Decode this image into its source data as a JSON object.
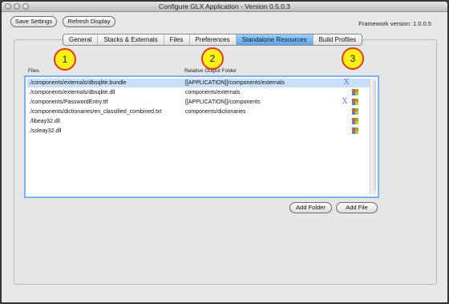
{
  "window": {
    "title": "Configure GLX Application - Version 0.5.0.3"
  },
  "toolbar": {
    "save_label": "Save Settings",
    "refresh_label": "Refresh Display"
  },
  "framework_version": "Framework version: 1.0.0.5",
  "tabs": [
    {
      "label": "General",
      "active": false
    },
    {
      "label": "Stacks & Externals",
      "active": false
    },
    {
      "label": "Files",
      "active": false
    },
    {
      "label": "Preferences",
      "active": false
    },
    {
      "label": "Standalone Resources",
      "active": true
    },
    {
      "label": "Build Profiles",
      "active": false
    }
  ],
  "callouts": [
    "1",
    "2",
    "3"
  ],
  "columns": {
    "files": "Files",
    "output": "Relative Output Folder"
  },
  "rows": [
    {
      "file": "./components/externals/dbsqlite.bundle",
      "output": "[[APPLICATION]]/components/externals",
      "selected": true,
      "icons": [
        "mac-x-icon"
      ]
    },
    {
      "file": "./components/externals/dbsqlite.dll",
      "output": "components/externals",
      "selected": false,
      "icons": [
        "windows-icon"
      ]
    },
    {
      "file": "./components/PasswordEntry.ttf",
      "output": "[[APPLICATION]]/components",
      "selected": false,
      "icons": [
        "mac-x-icon",
        "windows-icon"
      ]
    },
    {
      "file": "./components/dictionaries/en_classified_combined.txt",
      "output": "components/dictionaries",
      "selected": false,
      "icons": [
        "windows-icon"
      ]
    },
    {
      "file": "./libeay32.dll",
      "output": "",
      "selected": false,
      "icons": [
        "windows-icon"
      ]
    },
    {
      "file": "./ssleay32.dll",
      "output": "",
      "selected": false,
      "icons": [
        "windows-icon"
      ]
    }
  ],
  "buttons": {
    "add_folder": "Add Folder",
    "add_file": "Add File"
  },
  "colors": {
    "accent": "#6aa9ec",
    "selection": "#c9dff8",
    "callout_fill": "#fff018",
    "callout_border": "#e23a1e"
  }
}
